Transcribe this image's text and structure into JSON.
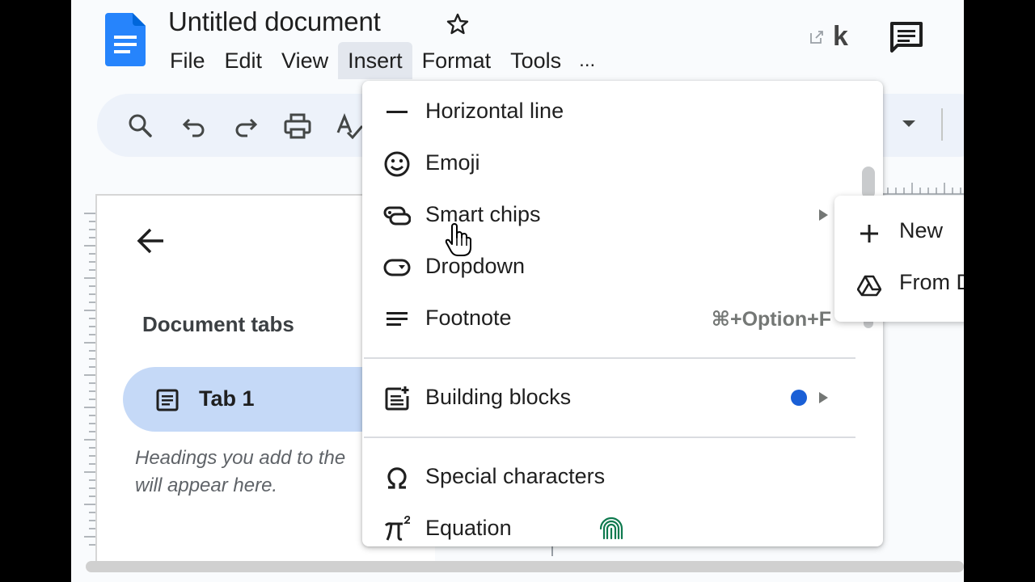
{
  "document": {
    "title": "Untitled document"
  },
  "menubar": {
    "items": [
      "File",
      "Edit",
      "View",
      "Insert",
      "Format",
      "Tools"
    ],
    "active": "Insert",
    "more": "..."
  },
  "header": {
    "extension_logo": "k"
  },
  "toolbar": {
    "icons": [
      "search-icon",
      "undo-icon",
      "redo-icon",
      "print-icon",
      "spellcheck-icon",
      "chevron-down-icon"
    ]
  },
  "sidebar": {
    "title": "Document tabs",
    "tab_label": "Tab 1",
    "hint": "Headings you add to the\nwill appear here."
  },
  "insert_menu": {
    "items": [
      {
        "label": "Horizontal line",
        "icon": "horizontal-line-icon"
      },
      {
        "label": "Emoji",
        "icon": "emoji-icon"
      },
      {
        "label": "Smart chips",
        "icon": "smart-chips-icon",
        "submenu": true
      },
      {
        "label": "Dropdown",
        "icon": "dropdown-icon"
      },
      {
        "label": "Footnote",
        "icon": "footnote-icon",
        "shortcut": "⌘+Option+F"
      },
      {
        "label": "Building blocks",
        "icon": "building-blocks-icon",
        "submenu": true,
        "badge": true
      },
      {
        "label": "Special characters",
        "icon": "omega-icon"
      },
      {
        "label": "Equation",
        "icon": "pi-squared-icon"
      }
    ]
  },
  "smart_chips_submenu": {
    "items": [
      {
        "label": "New",
        "icon": "plus-icon"
      },
      {
        "label": "From D",
        "icon": "drive-icon"
      }
    ]
  },
  "colors": {
    "accent_blue": "#1a5fd6",
    "tab_selected": "#c5d9f7",
    "toolbar_bg": "#edf2fa",
    "page_bg": "#f9fbfd"
  }
}
